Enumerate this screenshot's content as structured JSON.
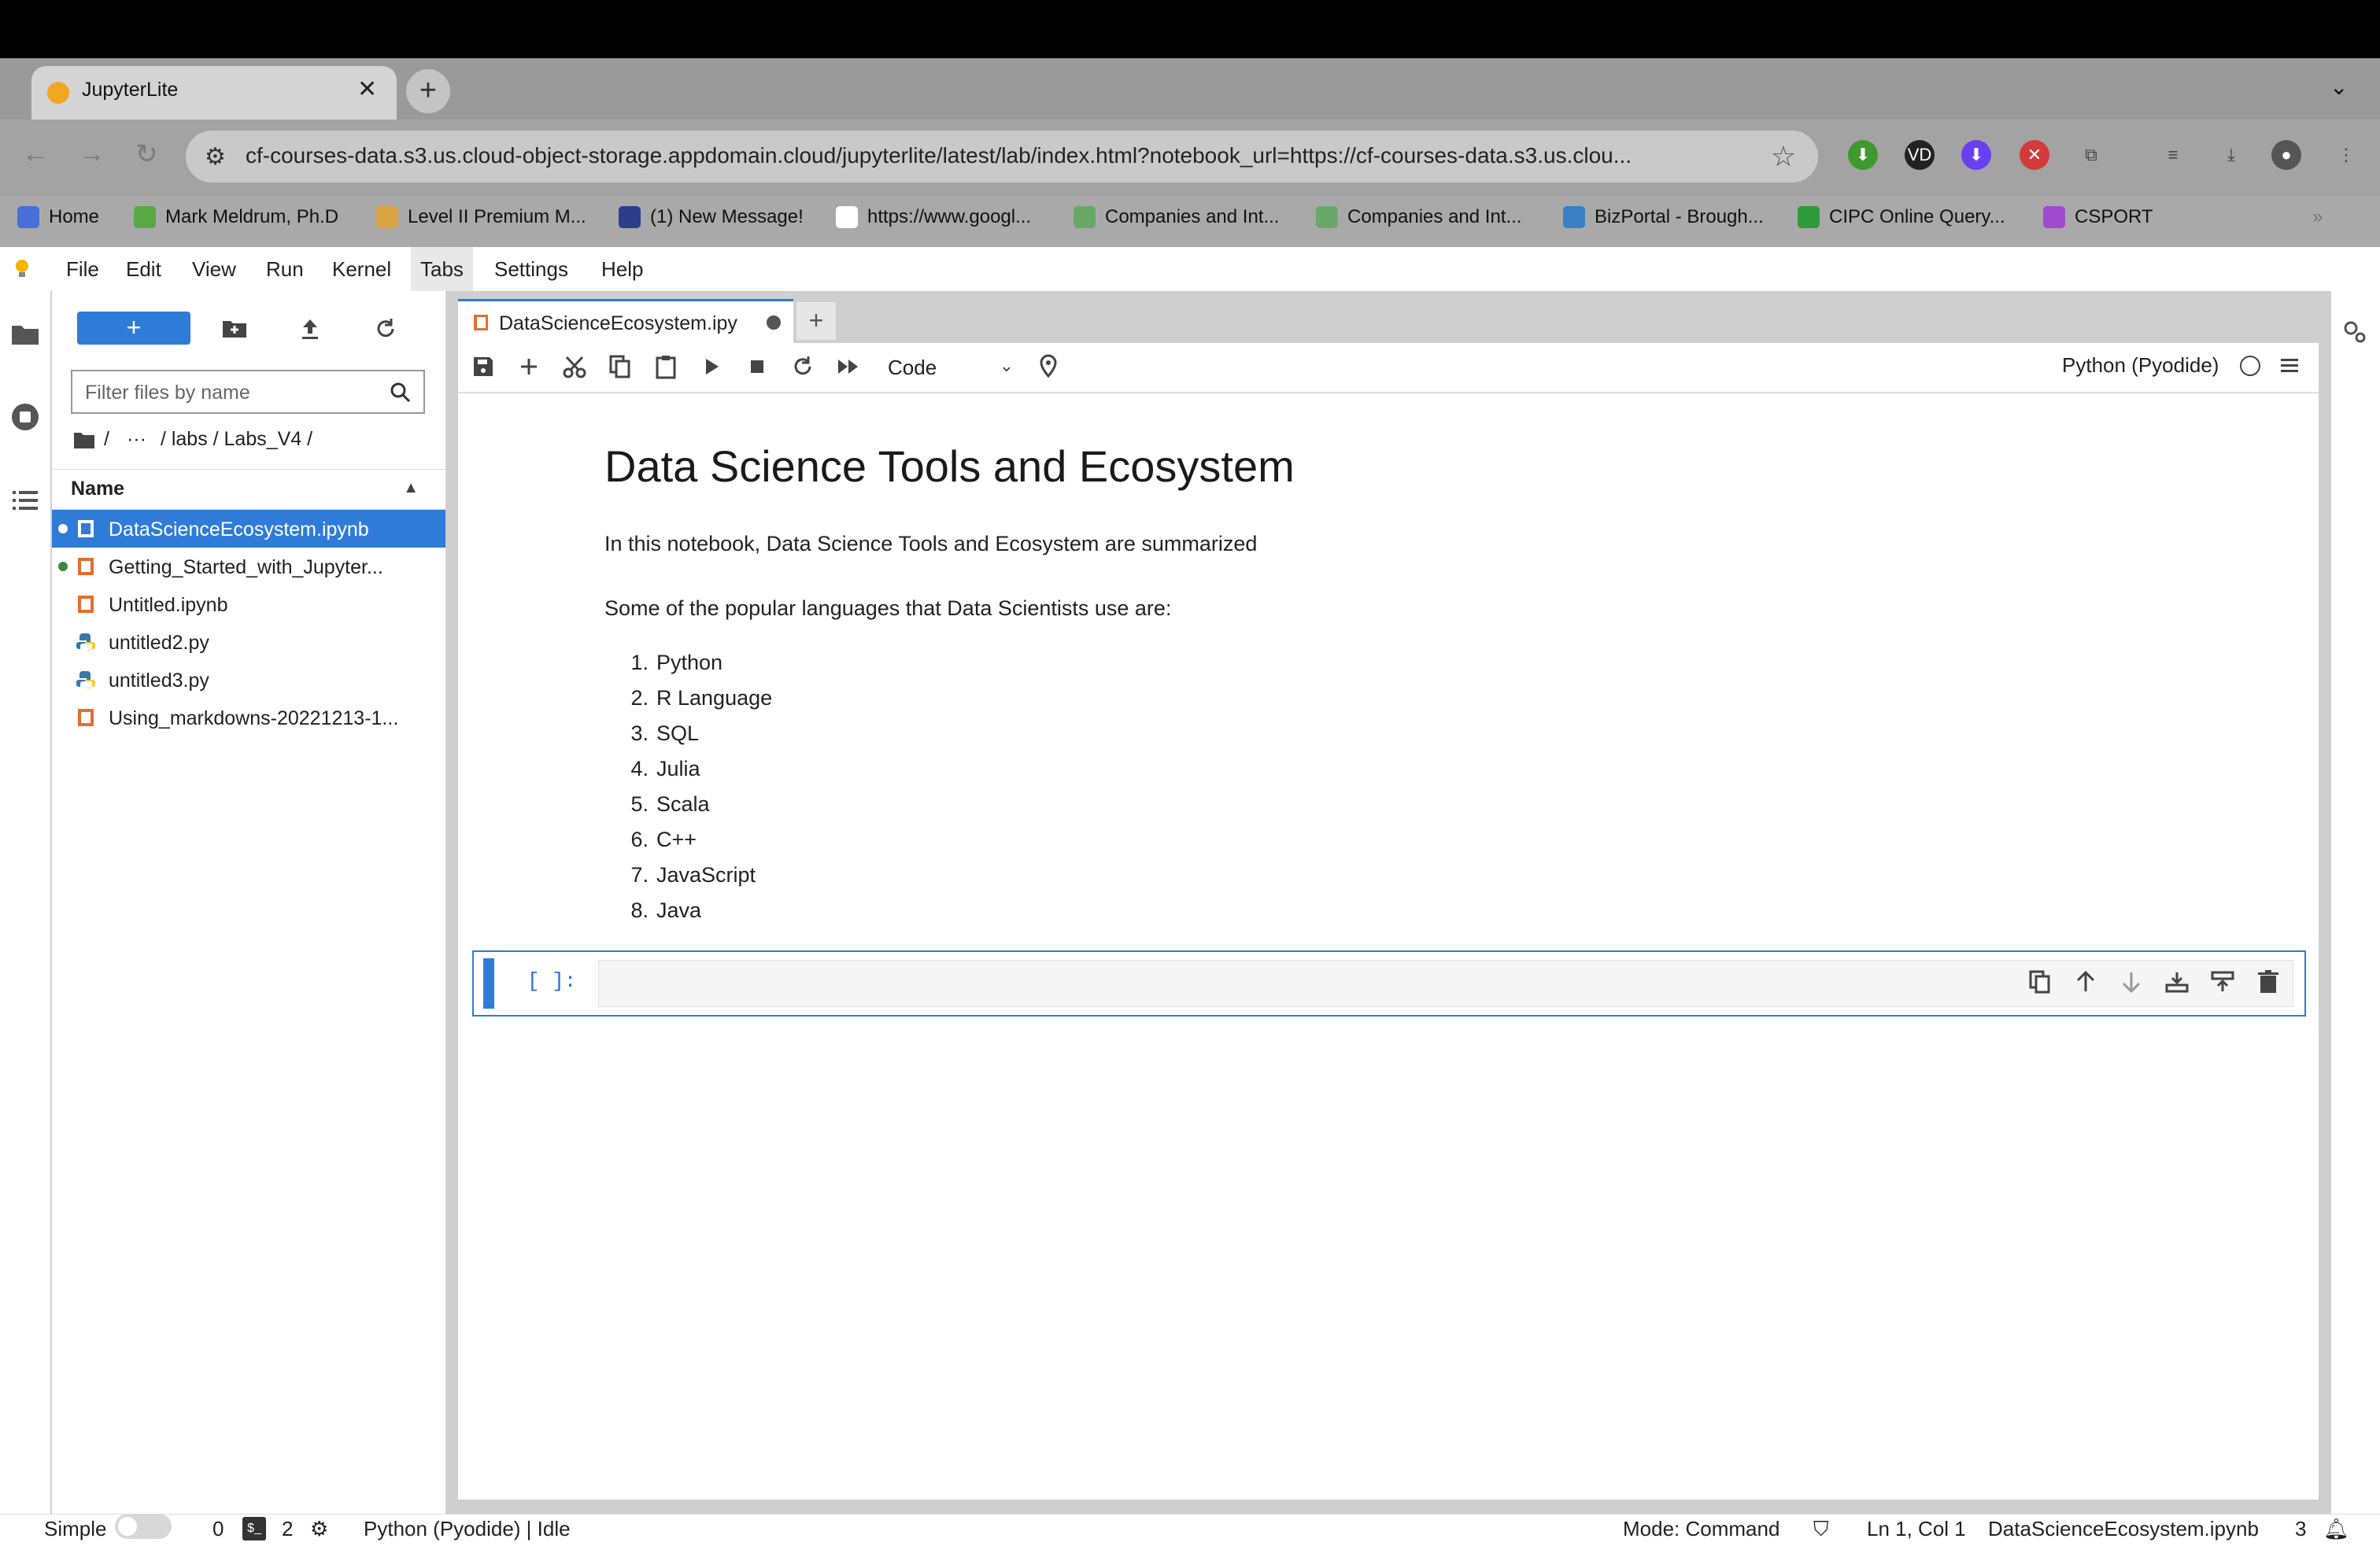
{
  "browser": {
    "tab_title": "JupyterLite",
    "tab_close": "✕",
    "new_tab": "+",
    "url": "cf-courses-data.s3.us.cloud-object-storage.appdomain.cloud/jupyterlite/latest/lab/index.html?notebook_url=https://cf-courses-data.s3.us.clou...",
    "bookmarks": [
      {
        "label": "Home",
        "color": "#4a6fd8"
      },
      {
        "label": "Mark Meldrum, Ph.D",
        "color": "#5aa845"
      },
      {
        "label": "Level II Premium M...",
        "color": "#d9a441"
      },
      {
        "label": "(1) New Message!",
        "color": "#2d3c8c"
      },
      {
        "label": "https://www.googl...",
        "color": "#ffffff"
      },
      {
        "label": "Companies and Int...",
        "color": "#6aa86a"
      },
      {
        "label": "Companies and Int...",
        "color": "#6aa86a"
      },
      {
        "label": "BizPortal - Brough...",
        "color": "#3a7fc4"
      },
      {
        "label": "CIPC Online Query...",
        "color": "#2e9a3a"
      },
      {
        "label": "CSPORT",
        "color": "#a04ad0"
      }
    ]
  },
  "menubar": {
    "items": [
      "File",
      "Edit",
      "View",
      "Run",
      "Kernel",
      "Tabs",
      "Settings",
      "Help"
    ],
    "active": "Tabs"
  },
  "filebrowser": {
    "new_label": "+",
    "filter_placeholder": "Filter files by name",
    "breadcrumb": {
      "root": "/",
      "ellipsis": "···",
      "path": "/ labs / Labs_V4 /"
    },
    "column_header": "Name",
    "files": [
      {
        "name": "DataScienceEcosystem.ipynb",
        "kind": "notebook",
        "running": true,
        "selected": true
      },
      {
        "name": "Getting_Started_with_Jupyter...",
        "kind": "notebook",
        "running": true,
        "selected": false
      },
      {
        "name": "Untitled.ipynb",
        "kind": "notebook",
        "running": false,
        "selected": false
      },
      {
        "name": "untitled2.py",
        "kind": "python",
        "running": false,
        "selected": false
      },
      {
        "name": "untitled3.py",
        "kind": "python",
        "running": false,
        "selected": false
      },
      {
        "name": "Using_markdowns-20221213-1...",
        "kind": "notebook",
        "running": false,
        "selected": false
      }
    ]
  },
  "notebook": {
    "tab_label": "DataScienceEcosystem.ipy",
    "add_tab": "+",
    "cell_type": "Code",
    "kernel": "Python (Pyodide)",
    "markdown": {
      "title": "Data Science Tools and Ecosystem",
      "intro": "In this notebook, Data Science Tools and Ecosystem are summarized",
      "languages_heading": "Some of the popular languages that Data Scientists use are:",
      "languages": [
        "Python",
        "R Language",
        "SQL",
        "Julia",
        "Scala",
        "C++",
        "JavaScript",
        "Java"
      ]
    },
    "code_cell": {
      "prompt": "[ ]:",
      "source": ""
    }
  },
  "statusbar": {
    "simple_label": "Simple",
    "terminals": "0",
    "kernels": "2",
    "kernel_status": "Python (Pyodide) | Idle",
    "mode": "Mode: Command",
    "cursor": "Ln 1, Col 1",
    "file": "DataScienceEcosystem.ipynb",
    "notifications": "3"
  },
  "colors": {
    "accent": "#2f7bd8",
    "notebook_icon": "#e46e2e",
    "running_dot_green": "#3a8a3a"
  }
}
